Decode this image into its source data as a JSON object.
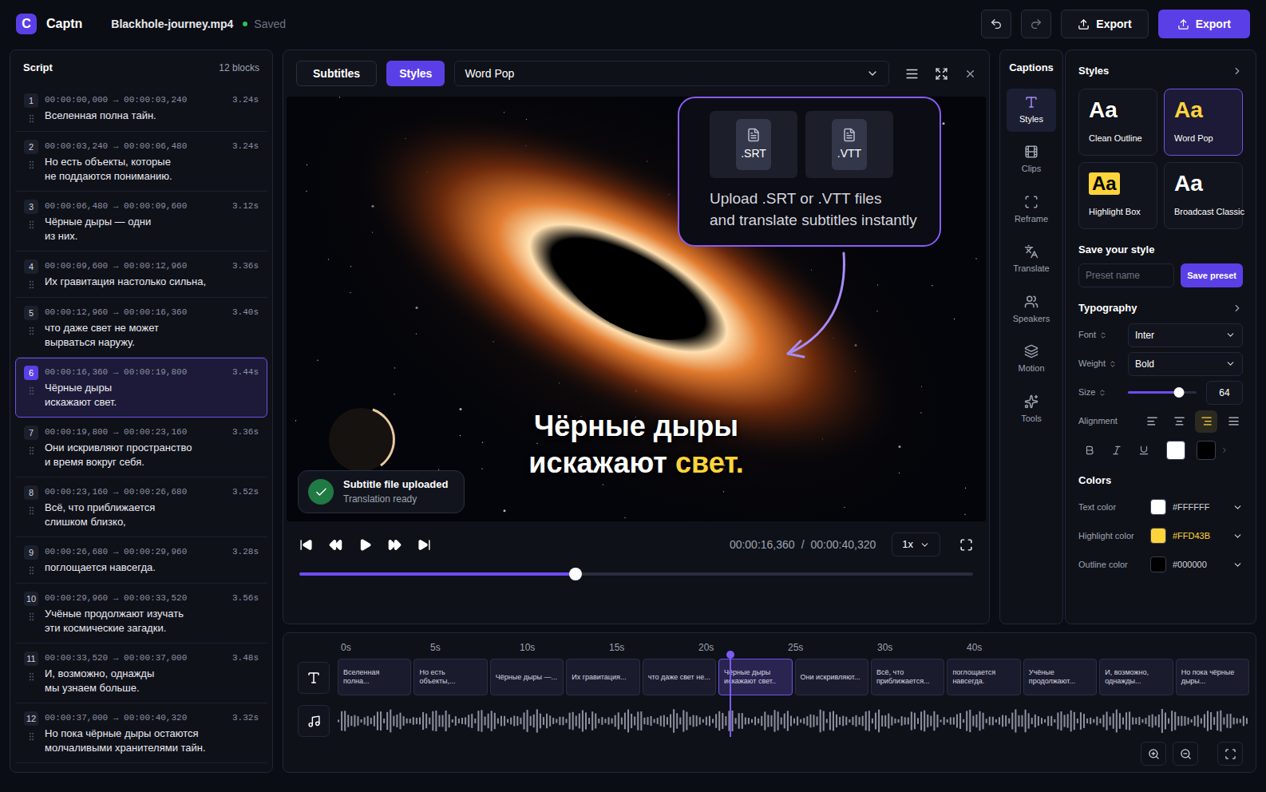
{
  "app": {
    "logo": "C",
    "name": "Captn",
    "file": "Blackhole-journey.mp4",
    "status": {
      "label": "Saved",
      "color": "#22C55E"
    }
  },
  "actions": [
    {
      "label": "Export",
      "kind": "outline"
    },
    {
      "label": "Export",
      "kind": "primary"
    }
  ],
  "script": {
    "title": "Script",
    "count": "12 blocks",
    "arrow": "→",
    "blocks": [
      {
        "index": "1",
        "start": "00:00:00,000",
        "end": "00:00:03,240",
        "duration": "3.24s",
        "lines": [
          "Вселенная полна тайн."
        ],
        "selected": false
      },
      {
        "index": "2",
        "start": "00:00:03,240",
        "end": "00:00:06,480",
        "duration": "3.24s",
        "lines": [
          "Но есть объекты, которые",
          "не поддаются пониманию."
        ],
        "selected": false
      },
      {
        "index": "3",
        "start": "00:00:06,480",
        "end": "00:00:09,600",
        "duration": "3.12s",
        "lines": [
          "Чёрные дыры — одни",
          "из них."
        ],
        "selected": false
      },
      {
        "index": "4",
        "start": "00:00:09,600",
        "end": "00:00:12,960",
        "duration": "3.36s",
        "lines": [
          "Их гравитация настолько сильна,"
        ],
        "selected": false
      },
      {
        "index": "5",
        "start": "00:00:12,960",
        "end": "00:00:16,360",
        "duration": "3.40s",
        "lines": [
          "что даже свет не может",
          "вырваться наружу."
        ],
        "selected": false
      },
      {
        "index": "6",
        "start": "00:00:16,360",
        "end": "00:00:19,800",
        "duration": "3.44s",
        "lines": [
          "Чёрные дыры",
          "искажают свет."
        ],
        "selected": true
      },
      {
        "index": "7",
        "start": "00:00:19,800",
        "end": "00:00:23,160",
        "duration": "3.36s",
        "lines": [
          "Они искривляют пространство",
          "и время вокруг себя."
        ],
        "selected": false
      },
      {
        "index": "8",
        "start": "00:00:23,160",
        "end": "00:00:26,680",
        "duration": "3.52s",
        "lines": [
          "Всё, что приближается",
          "слишком близко,"
        ],
        "selected": false
      },
      {
        "index": "9",
        "start": "00:00:26,680",
        "end": "00:00:29,960",
        "duration": "3.28s",
        "lines": [
          "поглощается навсегда."
        ],
        "selected": false
      },
      {
        "index": "10",
        "start": "00:00:29,960",
        "end": "00:00:33,520",
        "duration": "3.56s",
        "lines": [
          "Учёные продолжают изучать",
          "эти космические загадки."
        ],
        "selected": false
      },
      {
        "index": "11",
        "start": "00:00:33,520",
        "end": "00:00:37,000",
        "duration": "3.48s",
        "lines": [
          "И, возможно, однажды",
          "мы узнаем больше."
        ],
        "selected": false
      },
      {
        "index": "12",
        "start": "00:00:37,000",
        "end": "00:00:40,320",
        "duration": "3.32s",
        "lines": [
          "Но пока чёрные дыры остаются",
          "молчаливыми хранителями тайн."
        ],
        "selected": false
      }
    ]
  },
  "editor": {
    "tabs": [
      {
        "label": "Subtitles",
        "selected": false
      },
      {
        "label": "Styles",
        "selected": true
      }
    ],
    "preset": "Word Pop"
  },
  "preview": {
    "callout": {
      "files": [
        ".SRT",
        ".VTT"
      ],
      "lines": [
        "Upload .SRT or .VTT files",
        "and translate subtitles instantly"
      ]
    },
    "caption": [
      [
        {
          "text": "Чёрные",
          "highlighted": false
        },
        {
          "text": "дыры",
          "highlighted": false
        }
      ],
      [
        {
          "text": "искажают",
          "highlighted": false
        },
        {
          "text": "свет.",
          "highlighted": true
        }
      ]
    ],
    "highlight": "#FFD43B",
    "toast": {
      "title": "Subtitle file uploaded",
      "subtitle": "Translation ready"
    }
  },
  "player": {
    "current": "00:00:16,360",
    "separator": "/",
    "total": "00:00:40,320",
    "speed": "1x",
    "level": 0.41
  },
  "nav": {
    "title": "Captions",
    "items": [
      {
        "label": "Styles",
        "selected": true
      },
      {
        "label": "Clips",
        "selected": false
      },
      {
        "label": "Reframe",
        "selected": false
      },
      {
        "label": "Translate",
        "selected": false
      },
      {
        "label": "Speakers",
        "selected": false
      },
      {
        "label": "Motion",
        "selected": false
      },
      {
        "label": "Tools",
        "selected": false
      }
    ]
  },
  "styles": {
    "title": "Styles",
    "presets": [
      {
        "name": "Clean Outline",
        "preview": "Aa",
        "kind": "outline",
        "selected": false
      },
      {
        "name": "Word Pop",
        "preview": "Aa",
        "kind": "pop",
        "selected": true
      },
      {
        "name": "Highlight Box",
        "preview": "Aa",
        "kind": "box",
        "selected": false
      },
      {
        "name": "Broadcast Classic",
        "preview": "Aa",
        "kind": "classic",
        "selected": false
      }
    ],
    "save": {
      "title": "Save your style",
      "placeholder": "Preset name",
      "button": "Save preset"
    },
    "typography": {
      "title": "Typography",
      "font": {
        "label": "Font",
        "value": "Inter"
      },
      "weight": {
        "label": "Weight",
        "value": "Bold"
      },
      "size": {
        "label": "Size",
        "value": "64",
        "level": 0.74
      },
      "alignment": {
        "label": "Alignment",
        "options": [
          {
            "selected": false
          },
          {
            "selected": false
          },
          {
            "selected": true
          },
          {
            "selected": false
          }
        ]
      },
      "swatches": [
        {
          "color": "#FFFFFF"
        },
        {
          "color": "#000000"
        }
      ]
    },
    "colors": {
      "title": "Colors",
      "rows": [
        {
          "label": "Text color",
          "value": "#FFFFFF",
          "color": "#FFFFFF",
          "kind": "text"
        },
        {
          "label": "Highlight color",
          "value": "#FFD43B",
          "color": "#FFD43B",
          "kind": "highlight"
        },
        {
          "label": "Outline color",
          "value": "#000000",
          "color": "#000000",
          "kind": "outline"
        }
      ]
    }
  },
  "timeline": {
    "ruler": [
      "0s",
      "5s",
      "10s",
      "15s",
      "20s",
      "25s",
      "30s",
      "40s"
    ],
    "level": 0.43,
    "clips": [
      {
        "text": "Вселенная полна...",
        "selected": false
      },
      {
        "text": "Но есть объекты,...",
        "selected": false
      },
      {
        "text": "Чёрные дыры —...",
        "selected": false
      },
      {
        "text": "Их гравитация...",
        "selected": false
      },
      {
        "text": "что даже свет не...",
        "selected": false
      },
      {
        "text": "Чёрные дыры искажают свет..",
        "selected": true
      },
      {
        "text": "Они искривляют...",
        "selected": false
      },
      {
        "text": "Всё, что приближается...",
        "selected": false
      },
      {
        "text": "поглощается навсегда.",
        "selected": false
      },
      {
        "text": "Учёные продолжают...",
        "selected": false
      },
      {
        "text": "И, возможно, однажды...",
        "selected": false
      },
      {
        "text": "Но пока чёрные дыры...",
        "selected": false
      }
    ]
  }
}
